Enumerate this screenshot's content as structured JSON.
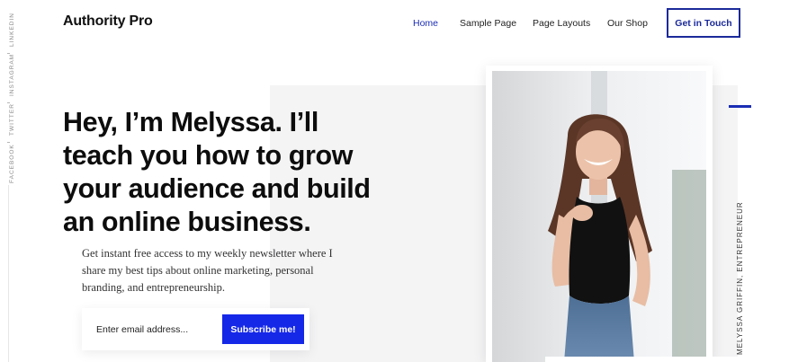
{
  "site": {
    "logo": "Authority Pro",
    "nav": [
      {
        "label": "Home",
        "active": true
      },
      {
        "label": "Sample Page",
        "active": false
      },
      {
        "label": "Page Layouts",
        "active": false
      },
      {
        "label": "Our Shop",
        "active": false
      }
    ],
    "cta_label": "Get in Touch"
  },
  "social": [
    "LINKEDIN",
    "INSTAGRAM",
    "TWITTER",
    "FACEBOOK"
  ],
  "hero": {
    "headline_lines": [
      "Hey, I’m Melyssa. I’ll",
      "teach you how to grow",
      "your audience and build",
      "an online business."
    ],
    "intro_lines": [
      "Get instant free access to my weekly newsletter where I",
      "share my best tips about online marketing, personal",
      "branding, and entrepreneurship."
    ],
    "email_placeholder": "Enter email address...",
    "subscribe_label": "Subscribe me!"
  },
  "portrait": {
    "caption": "MELYSSA GRIFFIN, ENTREPRENEUR"
  },
  "colors": {
    "accent": "#1528e8",
    "accent_dark": "#1b2a9a",
    "panel": "#f4f4f5"
  }
}
